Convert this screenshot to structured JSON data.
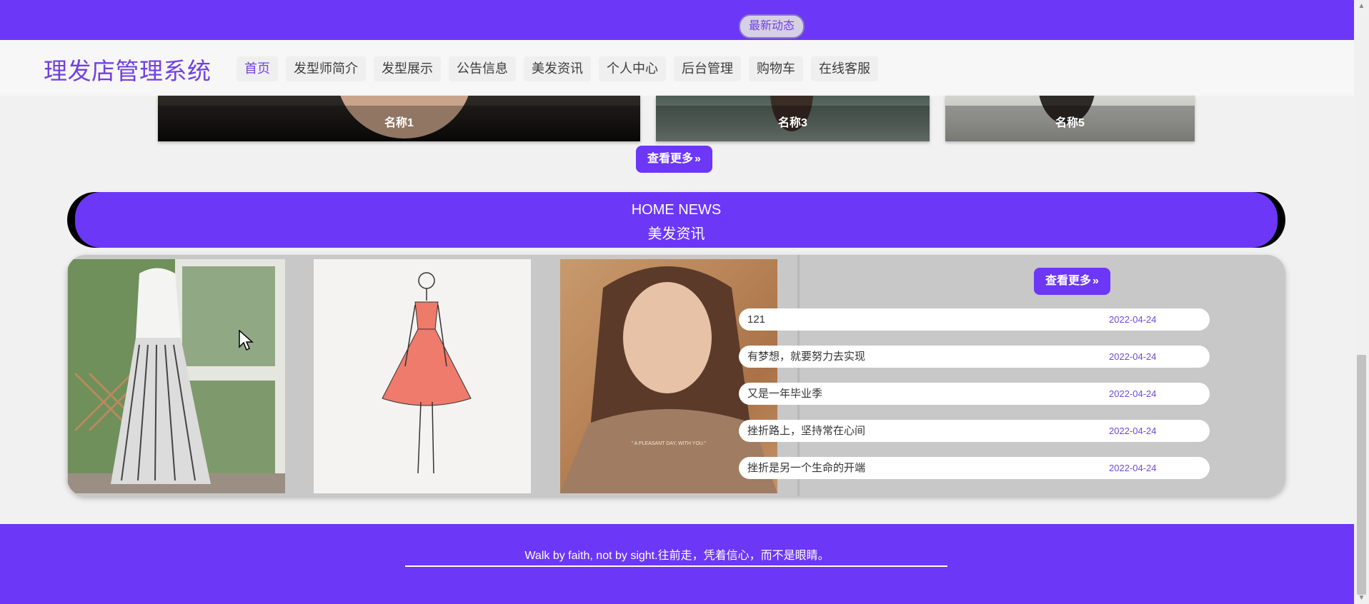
{
  "header": {
    "brand": "理发店管理系统",
    "nav": [
      {
        "label": "首页",
        "active": true
      },
      {
        "label": "发型师简介"
      },
      {
        "label": "发型展示"
      },
      {
        "label": "公告信息"
      },
      {
        "label": "美发资讯"
      },
      {
        "label": "个人中心"
      },
      {
        "label": "后台管理"
      },
      {
        "label": "购物车"
      },
      {
        "label": "在线客服"
      }
    ]
  },
  "showcase": {
    "items": [
      "名称1",
      "名称3",
      "名称5"
    ],
    "more_label": "查看更多",
    "more_icon": "double-chevron-right-icon"
  },
  "news": {
    "title_en": "HOME NEWS",
    "title_cn": "美发资讯",
    "latest_label": "最新动态",
    "more_label": "查看更多",
    "poster_text": "\" A PLEASANT DAY, WITH YOU.\"",
    "items": [
      {
        "title": "121",
        "date": "2022-04-24"
      },
      {
        "title": "有梦想，就要努力去实现",
        "date": "2022-04-24"
      },
      {
        "title": "又是一年毕业季",
        "date": "2022-04-24"
      },
      {
        "title": "挫折路上，坚持常在心间",
        "date": "2022-04-24"
      },
      {
        "title": "挫折是另一个生命的开端",
        "date": "2022-04-24"
      }
    ]
  },
  "footer": {
    "text": "Walk by faith, not by sight.往前走，凭着信心，而不是眼睛。"
  },
  "colors": {
    "accent": "#6c37f7",
    "brand_text": "#7041e0"
  }
}
